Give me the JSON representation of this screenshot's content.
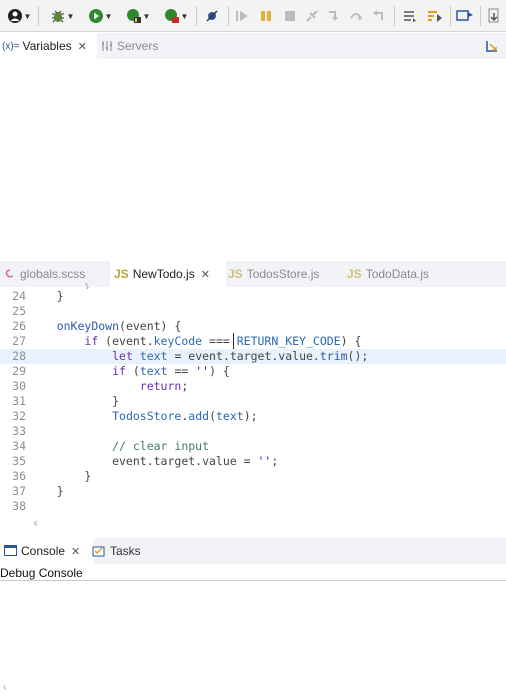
{
  "toolbar": {
    "buttons": [
      "run-profile",
      "debug",
      "run",
      "coverage",
      "external-tools",
      "skip-breakpoints",
      "resume",
      "suspend",
      "terminate",
      "disconnect",
      "step-into",
      "step-over",
      "step-return",
      "drop-to-frame",
      "use-step-filters",
      "open-perspective",
      "open-console"
    ]
  },
  "views": {
    "variables_label": "Variables",
    "variables_prefix": "(x)=",
    "servers_label": "Servers"
  },
  "editor_tabs": [
    {
      "label": "globals.scss",
      "icon": "sass-icon"
    },
    {
      "label": "NewTodo.js",
      "icon": "js-icon"
    },
    {
      "label": "TodosStore.js",
      "icon": "js-icon"
    },
    {
      "label": "TodoData.js",
      "icon": "js-icon"
    }
  ],
  "js_badge": "JS",
  "code_lines": [
    {
      "n": "24",
      "t": "    }"
    },
    {
      "n": "25",
      "t": ""
    },
    {
      "n": "26",
      "t": "    onKeyDown(event) {"
    },
    {
      "n": "27",
      "t": "        if (event.keyCode === RETURN_KEY_CODE) {"
    },
    {
      "n": "28",
      "t": "            let text = event.target.value.trim();"
    },
    {
      "n": "29",
      "t": "            if (text == '') {"
    },
    {
      "n": "30",
      "t": "                return;"
    },
    {
      "n": "31",
      "t": "            }"
    },
    {
      "n": "32",
      "t": "            TodosStore.add(text);"
    },
    {
      "n": "33",
      "t": ""
    },
    {
      "n": "34",
      "t": "            // clear input"
    },
    {
      "n": "35",
      "t": "            event.target.value = '';"
    },
    {
      "n": "36",
      "t": "        }"
    },
    {
      "n": "37",
      "t": "    }"
    },
    {
      "n": "38",
      "t": ""
    }
  ],
  "bottom": {
    "console_label": "Console",
    "tasks_label": "Tasks",
    "debug_console": "Debug Console"
  },
  "colors": {
    "accent": "#2a5aa8",
    "keyword": "#6b2fb3",
    "comment": "#3f7f5f",
    "string": "#2a00ff",
    "highlight": "#e8f2fe"
  }
}
